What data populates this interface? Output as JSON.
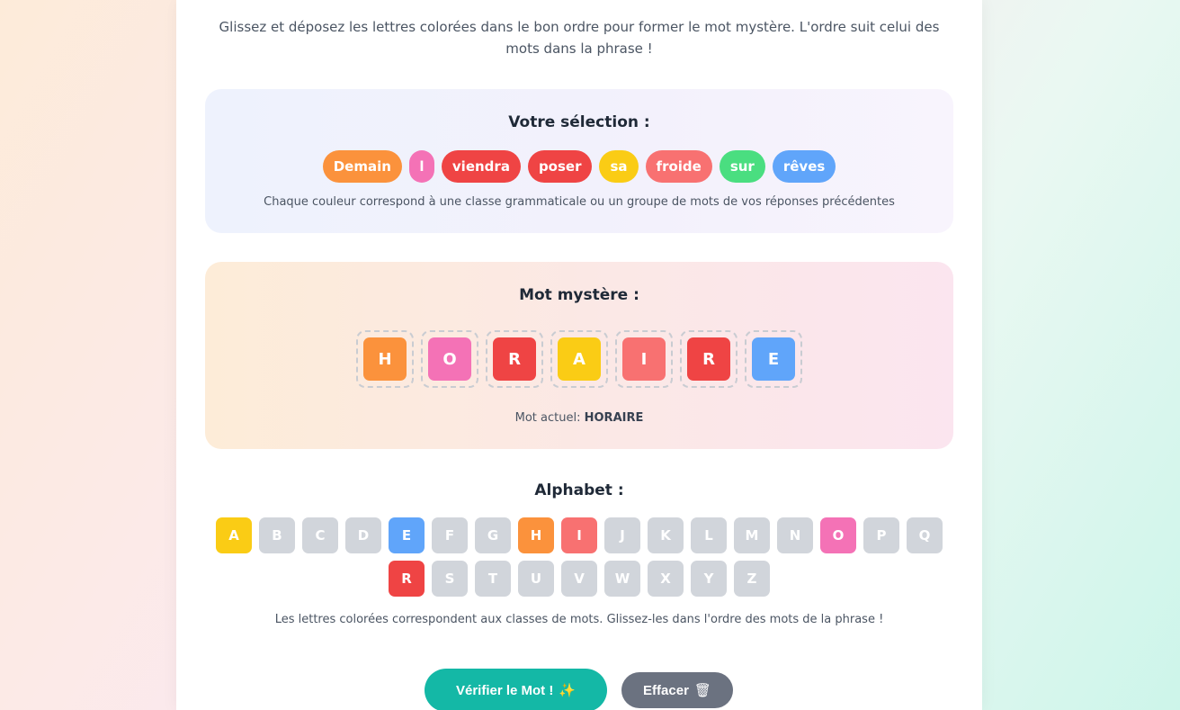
{
  "instructions": "Glissez et déposez les lettres colorées dans le bon ordre pour former le mot mystère. L'ordre suit celui des mots dans la phrase !",
  "selection": {
    "title": "Votre sélection :",
    "chips": [
      {
        "text": "Demain",
        "color": "#fb923c"
      },
      {
        "text": "l",
        "color": "#f472b6"
      },
      {
        "text": "viendra",
        "color": "#ef4444"
      },
      {
        "text": "poser",
        "color": "#ef4444"
      },
      {
        "text": "sa",
        "color": "#facc15"
      },
      {
        "text": "froide",
        "color": "#f87171"
      },
      {
        "text": "sur",
        "color": "#4ade80"
      },
      {
        "text": "rêves",
        "color": "#60a5fa"
      }
    ],
    "note": "Chaque couleur correspond à une classe grammaticale ou un groupe de mots de vos réponses précédentes"
  },
  "mystery": {
    "title": "Mot mystère :",
    "slots": [
      {
        "letter": "H",
        "color": "#fb923c"
      },
      {
        "letter": "O",
        "color": "#f472b6"
      },
      {
        "letter": "R",
        "color": "#ef4444"
      },
      {
        "letter": "A",
        "color": "#facc15"
      },
      {
        "letter": "I",
        "color": "#f87171"
      },
      {
        "letter": "R",
        "color": "#ef4444"
      },
      {
        "letter": "E",
        "color": "#60a5fa"
      }
    ],
    "current_label": "Mot actuel: ",
    "current_word": "HORAIRE"
  },
  "alphabet": {
    "title": "Alphabet :",
    "keys": [
      {
        "letter": "A",
        "color": "#facc15"
      },
      {
        "letter": "B",
        "color": "#d1d5db"
      },
      {
        "letter": "C",
        "color": "#d1d5db"
      },
      {
        "letter": "D",
        "color": "#d1d5db"
      },
      {
        "letter": "E",
        "color": "#60a5fa"
      },
      {
        "letter": "F",
        "color": "#d1d5db"
      },
      {
        "letter": "G",
        "color": "#d1d5db"
      },
      {
        "letter": "H",
        "color": "#fb923c"
      },
      {
        "letter": "I",
        "color": "#f87171"
      },
      {
        "letter": "J",
        "color": "#d1d5db"
      },
      {
        "letter": "K",
        "color": "#d1d5db"
      },
      {
        "letter": "L",
        "color": "#d1d5db"
      },
      {
        "letter": "M",
        "color": "#d1d5db"
      },
      {
        "letter": "N",
        "color": "#d1d5db"
      },
      {
        "letter": "O",
        "color": "#f472b6"
      },
      {
        "letter": "P",
        "color": "#d1d5db"
      },
      {
        "letter": "Q",
        "color": "#d1d5db"
      },
      {
        "letter": "R",
        "color": "#ef4444"
      },
      {
        "letter": "S",
        "color": "#d1d5db"
      },
      {
        "letter": "T",
        "color": "#d1d5db"
      },
      {
        "letter": "U",
        "color": "#d1d5db"
      },
      {
        "letter": "V",
        "color": "#d1d5db"
      },
      {
        "letter": "W",
        "color": "#d1d5db"
      },
      {
        "letter": "X",
        "color": "#d1d5db"
      },
      {
        "letter": "Y",
        "color": "#d1d5db"
      },
      {
        "letter": "Z",
        "color": "#d1d5db"
      }
    ],
    "note": "Les lettres colorées correspondent aux classes de mots. Glissez-les dans l'ordre des mots de la phrase !"
  },
  "actions": {
    "check_label": "Vérifier le Mot !",
    "check_icon": "✨",
    "clear_label": "Effacer",
    "clear_icon": "🗑"
  }
}
